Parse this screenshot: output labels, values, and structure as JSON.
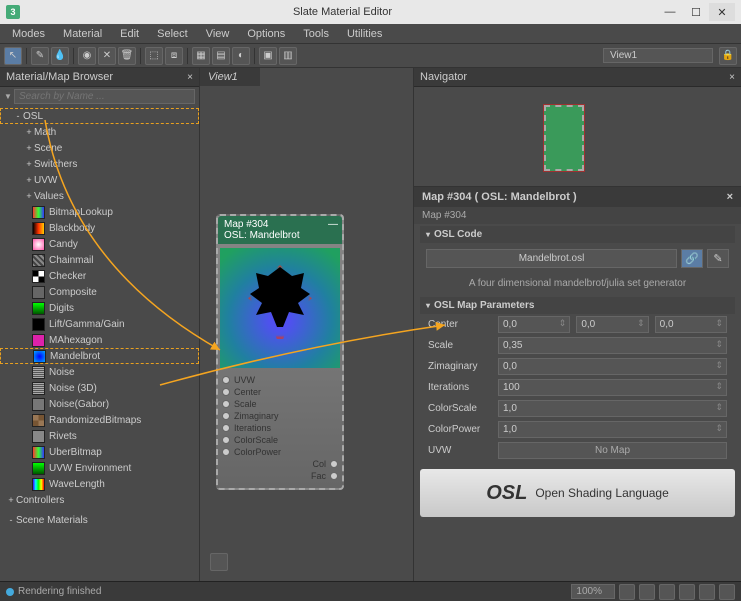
{
  "window": {
    "title": "Slate Material Editor",
    "app_icon_text": "3"
  },
  "menus": [
    "Modes",
    "Material",
    "Edit",
    "Select",
    "View",
    "Options",
    "Tools",
    "Utilities"
  ],
  "toolbar_view_dropdown": "View1",
  "browser": {
    "title": "Material/Map Browser",
    "close_glyph": "×",
    "search_placeholder": "Search by Name ...",
    "osl_label": "OSL",
    "categories": [
      "Math",
      "Scene",
      "Switchers",
      "UVW",
      "Values"
    ],
    "items": [
      {
        "label": "BitmapLookup",
        "swatch": "linear-gradient(90deg,#f33,#3f3,#33f)"
      },
      {
        "label": "Blackbody",
        "swatch": "linear-gradient(90deg,#000,#f30,#fc0)"
      },
      {
        "label": "Candy",
        "swatch": "radial-gradient(#fff,#f5a)"
      },
      {
        "label": "Chainmail",
        "swatch": "repeating-linear-gradient(45deg,#888 0 2px,#444 2px 4px)"
      },
      {
        "label": "Checker",
        "swatch": "repeating-conic-gradient(#fff 0 25%,#000 0 50%)"
      },
      {
        "label": "Composite",
        "swatch": "#666"
      },
      {
        "label": "Digits",
        "swatch": "linear-gradient(#0f0,#050)"
      },
      {
        "label": "Lift/Gamma/Gain",
        "swatch": "#000"
      },
      {
        "label": "MAhexagon",
        "swatch": "#d2a"
      },
      {
        "label": "Mandelbrot",
        "swatch": "radial-gradient(#00f,#0af)"
      },
      {
        "label": "Noise",
        "swatch": "repeating-linear-gradient(#aaa 0 1px,#555 1px 2px)"
      },
      {
        "label": "Noise (3D)",
        "swatch": "repeating-linear-gradient(#aaa 0 1px,#555 1px 2px)"
      },
      {
        "label": "Noise(Gabor)",
        "swatch": "#777"
      },
      {
        "label": "RandomizedBitmaps",
        "swatch": "repeating-conic-gradient(#753 0 25%,#975 0 50%)"
      },
      {
        "label": "Rivets",
        "swatch": "#888"
      },
      {
        "label": "UberBitmap",
        "swatch": "linear-gradient(90deg,#f33,#3f3,#33f)"
      },
      {
        "label": "UVW Environment",
        "swatch": "linear-gradient(#0f0,#050)"
      },
      {
        "label": "WaveLength",
        "swatch": "linear-gradient(90deg,#40f,#0ff,#0f0,#ff0,#f00)"
      }
    ],
    "controllers_label": "Controllers",
    "scene_materials_label": "Scene Materials"
  },
  "view_tab": "View1",
  "node": {
    "title_line1": "Map #304",
    "title_line2": "OSL: Mandelbrot",
    "inputs": [
      "UVW",
      "Center",
      "Scale",
      "Zimaginary",
      "Iterations",
      "ColorScale",
      "ColorPower"
    ],
    "outputs": [
      "Col",
      "Fac"
    ]
  },
  "navigator_title": "Navigator",
  "map_panel": {
    "title": "Map #304  ( OSL: Mandelbrot )",
    "subtitle": "Map #304",
    "osl_code_header": "OSL Code",
    "filename": "Mandelbrot.osl",
    "description": "A four dimensional mandelbrot/julia set generator",
    "params_header": "OSL Map Parameters",
    "params": {
      "center_label": "Center",
      "center_v1": "0,0",
      "center_v2": "0,0",
      "center_v3": "0,0",
      "scale_label": "Scale",
      "scale_v": "0,35",
      "zimag_label": "Zimaginary",
      "zimag_v": "0,0",
      "iter_label": "Iterations",
      "iter_v": "100",
      "cscale_label": "ColorScale",
      "cscale_v": "1,0",
      "cpow_label": "ColorPower",
      "cpow_v": "1,0",
      "uvw_label": "UVW",
      "uvw_btn": "No Map"
    },
    "logo_text": "OSL",
    "logo_tag": "Open Shading Language"
  },
  "status": {
    "text": "Rendering finished",
    "zoom": "100%"
  }
}
